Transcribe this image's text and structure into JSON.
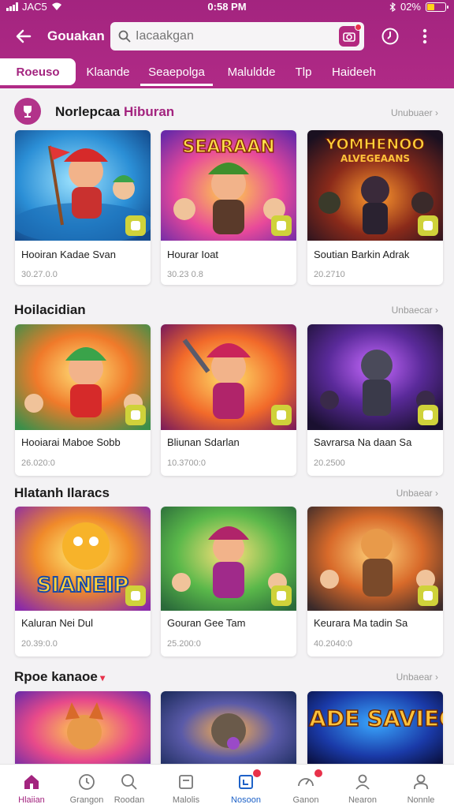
{
  "status_bar": {
    "carrier": "JAC5",
    "time": "0:58 PM",
    "battery": "02%"
  },
  "header": {
    "app_name": "Gouakan",
    "search_placeholder": "Iacaakgan",
    "icons": {
      "back": "back-arrow-icon",
      "camera": "camera-icon",
      "history": "clock-icon",
      "more": "more-vertical-icon"
    }
  },
  "tabs": [
    {
      "label": "Roeuso",
      "active": true
    },
    {
      "label": "Klaande",
      "active": false
    },
    {
      "label": "Seaepolga",
      "active": false
    },
    {
      "label": "Maluldde",
      "active": false
    },
    {
      "label": "Tlp",
      "active": false
    },
    {
      "label": "Haideeh",
      "active": false
    }
  ],
  "sections": [
    {
      "title": "Norlepcaa ",
      "title_accent": "Hiburan",
      "more": "Unubuaer",
      "items": [
        {
          "name": "Hooiran Kadae Svan",
          "sub": "30.27.0.0"
        },
        {
          "name": "Hourar Ioat",
          "sub": "30.23 0.8"
        },
        {
          "name": "Soutian Barkin Adrak",
          "sub": "20.2710"
        }
      ]
    },
    {
      "title": "Hoilacidian",
      "title_accent": "",
      "more": "Unbaecar",
      "items": [
        {
          "name": "Hooiarai Maboe Sobb",
          "sub": "26.020:0"
        },
        {
          "name": "Bliunan Sdarlan",
          "sub": "10.3700:0"
        },
        {
          "name": "Savrarsa Na daan Sa",
          "sub": "20.2500"
        }
      ]
    },
    {
      "title": "Hlatanh Ilaracs",
      "title_accent": "",
      "more": "Unbaear",
      "items": [
        {
          "name": "Kaluran Nei Dul",
          "sub": "20.39:0.0"
        },
        {
          "name": "Gouran Gee Tam",
          "sub": "25.200:0"
        },
        {
          "name": "Keurara Ma tadin Sa",
          "sub": "40.2040:0"
        }
      ]
    },
    {
      "title": "Rpoe kanaoe",
      "title_accent": "",
      "more": "Unbaear",
      "items": [
        {
          "name": "",
          "sub": ""
        },
        {
          "name": "",
          "sub": ""
        },
        {
          "name": "SHADE SAVIEGN",
          "sub": ""
        }
      ]
    }
  ],
  "bottom_nav": [
    {
      "label": "Hlaiian",
      "icon": "home-icon",
      "active": true
    },
    {
      "label": "Grangon",
      "icon": "clock-icon",
      "active": false
    },
    {
      "label": "Roodan",
      "icon": "search-icon",
      "active": false
    },
    {
      "label": "Malolis",
      "icon": "window-icon",
      "active": false
    },
    {
      "label": "Nosoon",
      "icon": "bookmark-icon",
      "active": false
    },
    {
      "label": "Ganon",
      "icon": "speedometer-icon",
      "active": false
    },
    {
      "label": "Nearon",
      "icon": "person-icon",
      "active": false
    },
    {
      "label": "Nonnle",
      "icon": "user-icon",
      "active": false
    }
  ],
  "colors": {
    "brand": "#a3247f",
    "badge": "#e8314a",
    "chip": "#cfd23a"
  }
}
